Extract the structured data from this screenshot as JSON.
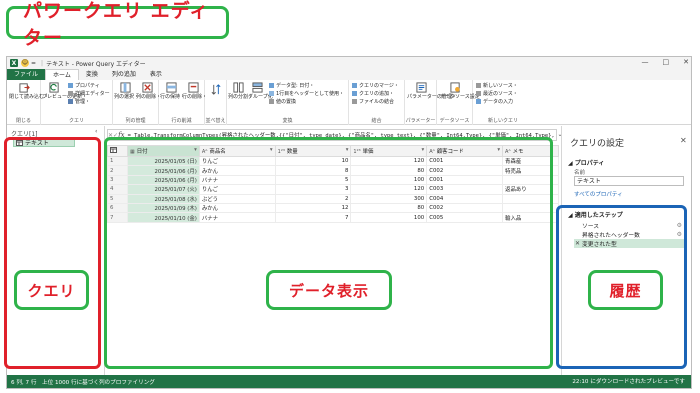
{
  "annotation": {
    "title": "パワークエリ エディター",
    "query_label": "クエリ",
    "data_label": "データ表示",
    "history_label": "履歴"
  },
  "window": {
    "title": "テキスト - Power Query エディター",
    "quick_access": "=",
    "controls": {
      "minimize": "—",
      "maximize": "□",
      "close": "✕"
    }
  },
  "menu": [
    "ファイル",
    "ホーム",
    "変換",
    "列の追加",
    "表示"
  ],
  "ribbon": {
    "groups": [
      {
        "label": "閉じる",
        "buttons": [
          "閉じて読み込む・"
        ]
      },
      {
        "label": "クエリ",
        "buttons": [
          "プレビューの更新・"
        ],
        "small": [
          "プロパティ",
          "詳細エディター",
          "管理・"
        ]
      },
      {
        "label": "列の管理",
        "buttons": [
          "列の選択・",
          "列の削除・"
        ]
      },
      {
        "label": "行の削減",
        "buttons": [
          "行の保持・",
          "行の削除・"
        ]
      },
      {
        "label": "並べ替え",
        "buttons": [
          ""
        ]
      },
      {
        "label": "変換",
        "buttons": [
          "列の分割・",
          "グループ化"
        ],
        "small": [
          "データ型: 日付・",
          "1行目をヘッダーとして使用・",
          "値の置換"
        ]
      },
      {
        "label": "結合",
        "small": [
          "クエリのマージ・",
          "クエリの追加・",
          "ファイルの結合"
        ]
      },
      {
        "label": "パラメーター",
        "buttons": [
          "パラメーターの管理・"
        ]
      },
      {
        "label": "データソース",
        "buttons": [
          "データソース設定"
        ]
      },
      {
        "label": "新しいクエリ",
        "small": [
          "新しいソース・",
          "最近のソース・",
          "データの入力"
        ]
      }
    ]
  },
  "query_pane": {
    "header": "クエリ[1]",
    "collapse": "‹",
    "items": [
      "テキスト"
    ]
  },
  "formula_bar": {
    "cancel": "✕",
    "confirm": "✓",
    "fx": "fx",
    "text": "= Table.TransformColumnTypes(昇格されたヘッダー数,{{\"日付\", type date}, {\"商品名\", type text}, {\"数量\", Int64.Type}, {\"単価\", Int64.Type}, {\"顧客コード\", type text}, {\"メモ\", type text}})",
    "expand": "⌄"
  },
  "grid": {
    "columns": [
      {
        "type": "",
        "name": ""
      },
      {
        "type": "▦",
        "name": "日付"
      },
      {
        "type": "Aᴬ",
        "name": "商品名"
      },
      {
        "type": "1²³",
        "name": "数量"
      },
      {
        "type": "1²³",
        "name": "単価"
      },
      {
        "type": "Aᴬ",
        "name": "顧客コード"
      },
      {
        "type": "Aᴬ",
        "name": "メモ"
      }
    ],
    "rows": [
      [
        "1",
        "2025/01/05 (日)",
        "りんご",
        "10",
        "120",
        "C001",
        "青森産"
      ],
      [
        "2",
        "2025/01/06 (月)",
        "みかん",
        "8",
        "80",
        "C002",
        "特売品"
      ],
      [
        "3",
        "2025/01/06 (月)",
        "バナナ",
        "5",
        "100",
        "C001",
        ""
      ],
      [
        "4",
        "2025/01/07 (火)",
        "りんご",
        "3",
        "120",
        "C003",
        "返品あり"
      ],
      [
        "5",
        "2025/01/08 (水)",
        "ぶどう",
        "2",
        "300",
        "C004",
        ""
      ],
      [
        "6",
        "2025/01/09 (木)",
        "みかん",
        "12",
        "80",
        "C002",
        ""
      ],
      [
        "7",
        "2025/01/10 (金)",
        "バナナ",
        "7",
        "100",
        "C005",
        "輸入品"
      ]
    ]
  },
  "settings": {
    "title": "クエリの設定",
    "close": "✕",
    "properties_header": "◢ プロパティ",
    "name_label": "名前",
    "name_value": "テキスト",
    "all_properties": "すべてのプロパティ",
    "steps_header": "◢ 適用したステップ",
    "steps": [
      "ソース",
      "昇格されたヘッダー数",
      "変更された型"
    ]
  },
  "status": {
    "left": "6 列, 7 行　上位 1000 行に基づく列のプロファイリング",
    "right": "22:10 にダウンロードされたプレビューです"
  },
  "colors": {
    "annotation_green": "#2fb34a",
    "annotation_red": "#e0202a",
    "query_box": "#e0202a",
    "data_box": "#2fb34a",
    "history_box": "#1b64b6",
    "excel_green": "#217346"
  }
}
